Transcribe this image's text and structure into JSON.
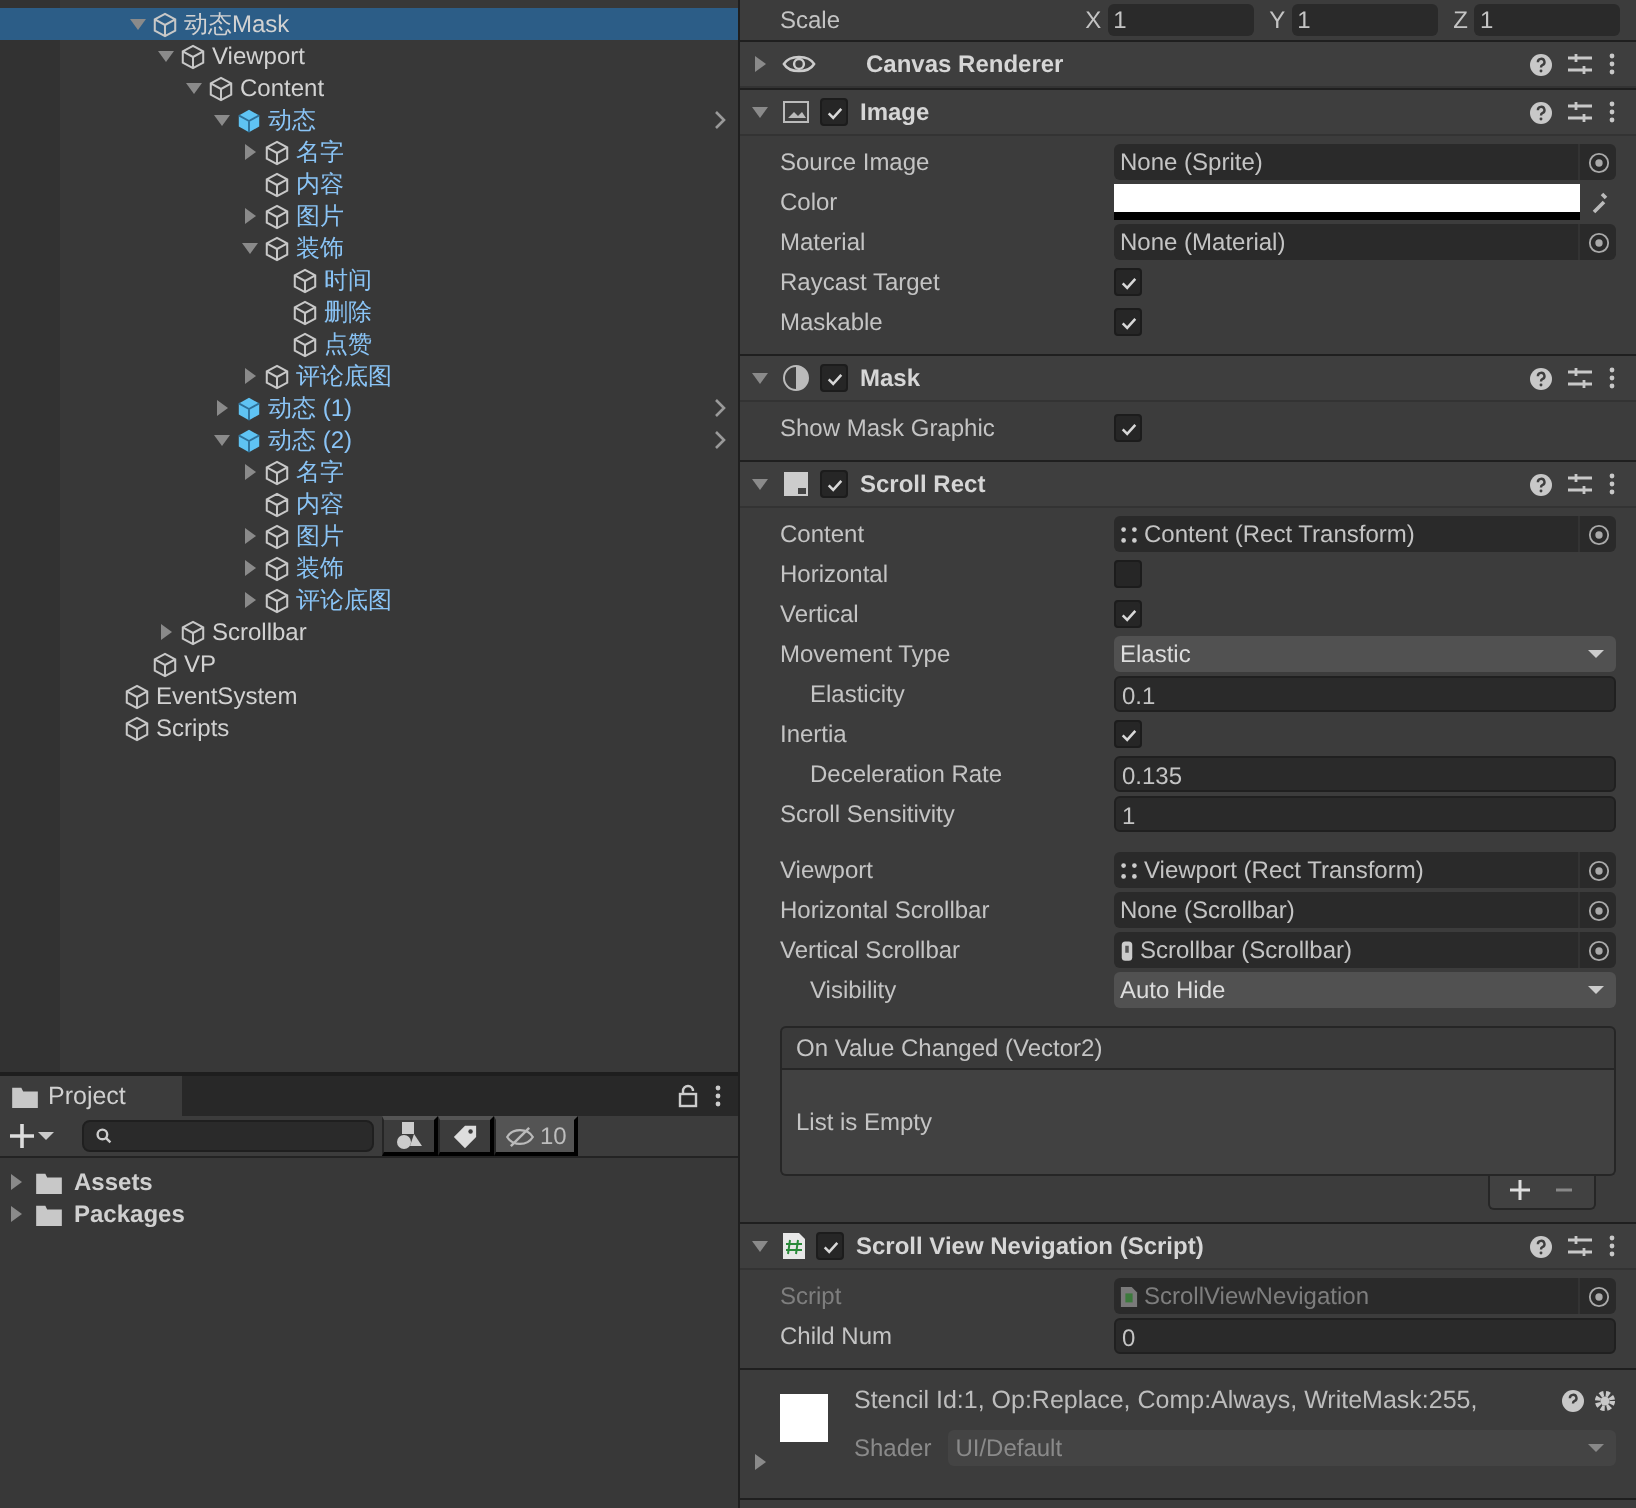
{
  "hierarchy": {
    "nested_items": [
      {
        "name": "动态Mask",
        "kind": "object",
        "selected": true,
        "expanded": true,
        "children": [
          {
            "name": "Viewport",
            "kind": "object",
            "selected": false,
            "expanded": true,
            "children": [
              {
                "name": "Content",
                "kind": "object",
                "selected": false,
                "expanded": true,
                "children": [
                  {
                    "name": "动态",
                    "kind": "prefab",
                    "selected": false,
                    "expanded": true,
                    "children": [
                      {
                        "name": "名字",
                        "kind": "prefab_child",
                        "selected": false,
                        "expanded": false
                      },
                      {
                        "name": "内容",
                        "kind": "prefab_child",
                        "selected": false
                      },
                      {
                        "name": "图片",
                        "kind": "prefab_child",
                        "selected": false,
                        "expanded": false
                      },
                      {
                        "name": "装饰",
                        "kind": "prefab_child",
                        "selected": false,
                        "expanded": true,
                        "children": [
                          {
                            "name": "时间",
                            "kind": "prefab_child",
                            "selected": false
                          },
                          {
                            "name": "删除",
                            "kind": "prefab_child",
                            "selected": false
                          },
                          {
                            "name": "点赞",
                            "kind": "prefab_child",
                            "selected": false
                          }
                        ]
                      },
                      {
                        "name": "评论底图",
                        "kind": "prefab_child",
                        "selected": false,
                        "expanded": false
                      }
                    ]
                  },
                  {
                    "name": "动态 (1)",
                    "kind": "prefab",
                    "selected": false,
                    "expanded": false
                  },
                  {
                    "name": "动态 (2)",
                    "kind": "prefab",
                    "selected": false,
                    "expanded": true,
                    "children": [
                      {
                        "name": "名字",
                        "kind": "prefab_child",
                        "selected": false,
                        "expanded": false
                      },
                      {
                        "name": "内容",
                        "kind": "prefab_child",
                        "selected": false
                      },
                      {
                        "name": "图片",
                        "kind": "prefab_child",
                        "selected": false,
                        "expanded": false
                      },
                      {
                        "name": "装饰",
                        "kind": "prefab_child",
                        "selected": false,
                        "expanded": false
                      },
                      {
                        "name": "评论底图",
                        "kind": "prefab_child",
                        "selected": false,
                        "expanded": false
                      }
                    ]
                  }
                ]
              }
            ]
          },
          {
            "name": "Scrollbar",
            "kind": "object",
            "selected": false,
            "expanded": false
          }
        ]
      },
      {
        "name": "VP",
        "kind": "object",
        "selected": false
      }
    ],
    "root_items": [
      {
        "name": "EventSystem",
        "kind": "object",
        "selected": false
      },
      {
        "name": "Scripts",
        "kind": "object",
        "selected": false
      }
    ]
  },
  "project": {
    "tab": "Project",
    "hidden_count": "10",
    "items": [
      {
        "name": "Assets",
        "expanded": false
      },
      {
        "name": "Packages",
        "expanded": false
      }
    ]
  },
  "inspector": {
    "scale_row": {
      "label": "Scale",
      "axes": [
        {
          "axis": "X",
          "value": "1"
        },
        {
          "axis": "Y",
          "value": "1"
        },
        {
          "axis": "Z",
          "value": "1"
        }
      ]
    },
    "components": [
      {
        "kind": "canvas_renderer",
        "title": "Canvas Renderer",
        "expanded": false
      },
      {
        "kind": "image",
        "title": "Image",
        "enabled": true,
        "expanded": true,
        "fields": [
          {
            "kind": "object",
            "label": "Source Image",
            "value": "None (Sprite)",
            "indented": false
          },
          {
            "kind": "color",
            "label": "Color",
            "color": "#ffffff",
            "indented": false
          },
          {
            "kind": "object",
            "label": "Material",
            "value": "None (Material)",
            "indented": false
          },
          {
            "kind": "checkbox",
            "label": "Raycast Target",
            "checked": true,
            "indented": false
          },
          {
            "kind": "checkbox",
            "label": "Maskable",
            "checked": true,
            "indented": false
          }
        ]
      },
      {
        "kind": "mask",
        "title": "Mask",
        "enabled": true,
        "expanded": true,
        "fields": [
          {
            "kind": "checkbox",
            "label": "Show Mask Graphic",
            "checked": true,
            "indented": false
          }
        ]
      },
      {
        "kind": "scroll_rect",
        "title": "Scroll Rect",
        "enabled": true,
        "expanded": true,
        "fields": [
          {
            "kind": "rect_transform_ref",
            "label": "Content",
            "value": "Content (Rect Transform)",
            "indented": false
          },
          {
            "kind": "checkbox",
            "label": "Horizontal",
            "checked": false,
            "indented": false
          },
          {
            "kind": "checkbox",
            "label": "Vertical",
            "checked": true,
            "indented": false
          },
          {
            "kind": "dropdown",
            "label": "Movement Type",
            "value": "Elastic",
            "indented": false
          },
          {
            "kind": "number",
            "label": "Elasticity",
            "value": "0.1",
            "indented": true
          },
          {
            "kind": "checkbox",
            "label": "Inertia",
            "checked": true,
            "indented": false
          },
          {
            "kind": "number",
            "label": "Deceleration Rate",
            "value": "0.135",
            "indented": true
          },
          {
            "kind": "number",
            "label": "Scroll Sensitivity",
            "value": "1",
            "indented": false
          },
          {
            "kind": "spacer"
          },
          {
            "kind": "rect_transform_ref",
            "label": "Viewport",
            "value": "Viewport (Rect Transform)",
            "indented": false
          },
          {
            "kind": "object",
            "label": "Horizontal Scrollbar",
            "value": "None (Scrollbar)",
            "indented": false
          },
          {
            "kind": "scrollbar_ref",
            "label": "Vertical Scrollbar",
            "value": "Scrollbar (Scrollbar)",
            "indented": false
          },
          {
            "kind": "dropdown",
            "label": "Visibility",
            "value": "Auto Hide",
            "indented": true
          },
          {
            "kind": "event",
            "label": "On Value Changed (Vector2)",
            "empty_text": "List is Empty"
          }
        ]
      },
      {
        "kind": "script",
        "title": "Scroll View Nevigation (Script)",
        "enabled": true,
        "expanded": true,
        "fields": [
          {
            "kind": "script_ref",
            "label": "Script",
            "value": "ScrollViewNevigation",
            "indented": false,
            "disabled": true
          },
          {
            "kind": "number",
            "label": "Child Num",
            "value": "0",
            "indented": false,
            "disabled": false
          }
        ]
      }
    ],
    "material": {
      "info": "Stencil Id:1, Op:Replace, Comp:Always, WriteMask:255,",
      "shader_label": "Shader",
      "shader": "UI/Default",
      "expanded": false
    }
  }
}
